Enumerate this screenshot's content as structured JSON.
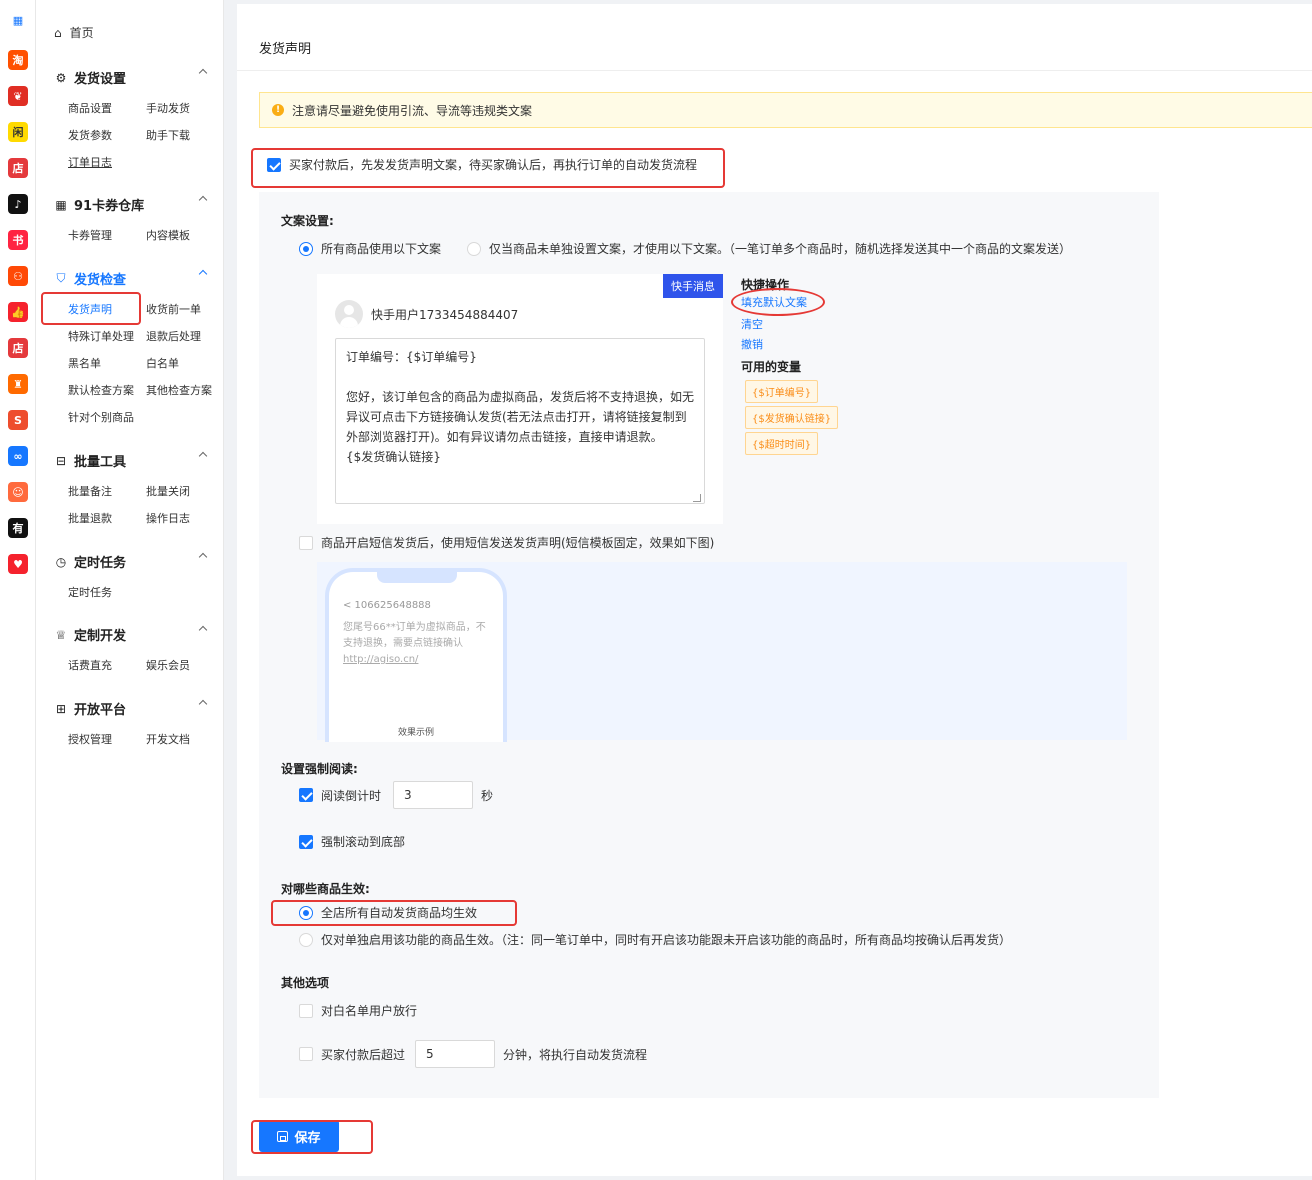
{
  "rail": {
    "items": [
      {
        "name": "qr-app-icon",
        "glyph": "▦",
        "bg": "#ffffff",
        "fg": "#1677ff"
      },
      {
        "name": "taobao-icon",
        "glyph": "淘",
        "bg": "#ff5000",
        "fg": "#ffffff"
      },
      {
        "name": "pinduoduo-icon",
        "glyph": "❦",
        "bg": "#e02e24",
        "fg": "#ffffff"
      },
      {
        "name": "xianyu-icon",
        "glyph": "闲",
        "bg": "#ffda00",
        "fg": "#333333"
      },
      {
        "name": "xiaohongshu-shop-icon",
        "glyph": "店",
        "bg": "#e4393c",
        "fg": "#ffffff"
      },
      {
        "name": "douyin-icon",
        "glyph": "♪",
        "bg": "#111111",
        "fg": "#ffffff"
      },
      {
        "name": "xiaohongshu-icon",
        "glyph": "书",
        "bg": "#ff2442",
        "fg": "#ffffff"
      },
      {
        "name": "kuaishou-icon",
        "glyph": "⚇",
        "bg": "#ff4906",
        "fg": "#ffffff"
      },
      {
        "name": "thumbs-up-icon",
        "glyph": "👍",
        "bg": "#f5222d",
        "fg": "#ffffff"
      },
      {
        "name": "store-icon",
        "glyph": "店",
        "bg": "#e4393c",
        "fg": "#ffffff"
      },
      {
        "name": "shopping-bag-icon",
        "glyph": "♜",
        "bg": "#ff6a00",
        "fg": "#ffffff"
      },
      {
        "name": "shopee-icon",
        "glyph": "S",
        "bg": "#ee4d2d",
        "fg": "#ffffff"
      },
      {
        "name": "link-icon",
        "glyph": "∞",
        "bg": "#1677ff",
        "fg": "#ffffff"
      },
      {
        "name": "smile-icon",
        "glyph": "☺",
        "bg": "#ff6a3d",
        "fg": "#ffffff"
      },
      {
        "name": "youzan-icon",
        "glyph": "有",
        "bg": "#111111",
        "fg": "#ffffff"
      },
      {
        "name": "heart-app-icon",
        "glyph": "♥",
        "bg": "#f5222d",
        "fg": "#ffffff"
      }
    ]
  },
  "sidebar": {
    "home": "首页",
    "groups": {
      "ship": {
        "title": "发货设置",
        "items": [
          "商品设置",
          "手动发货",
          "发货参数",
          "助手下载",
          "订单日志"
        ]
      },
      "card": {
        "title": "91卡券仓库",
        "items": [
          "卡券管理",
          "内容模板"
        ]
      },
      "check": {
        "title": "发货检查",
        "items": [
          "发货声明",
          "收货前一单",
          "特殊订单处理",
          "退款后处理",
          "黑名单",
          "白名单",
          "默认检查方案",
          "其他检查方案",
          "针对个别商品"
        ]
      },
      "batch": {
        "title": "批量工具",
        "items": [
          "批量备注",
          "批量关闭",
          "批量退款",
          "操作日志"
        ]
      },
      "timer": {
        "title": "定时任务",
        "items": [
          "定时任务"
        ]
      },
      "custom": {
        "title": "定制开发",
        "items": [
          "话费直充",
          "娱乐会员"
        ]
      },
      "open": {
        "title": "开放平台",
        "items": [
          "授权管理",
          "开发文档"
        ]
      }
    }
  },
  "main": {
    "title": "发货声明",
    "notice": "注意请尽量避免使用引流、导流等违规类文案",
    "enable_label": "买家付款后，先发发货声明文案，待买家确认后，再执行订单的自动发货流程",
    "copy_settings": {
      "label": "文案设置:",
      "opt_all": "所有商品使用以下文案",
      "opt_fallback": "仅当商品未单独设置文案，才使用以下文案。（一笔订单多个商品时，随机选择发送其中一个商品的文案发送）"
    },
    "message": {
      "badge": "快手消息",
      "username": "快手用户1733454884407",
      "text": "订单编号：{$订单编号}\n\n您好，该订单包含的商品为虚拟商品，发货后将不支持退换，如无异议可点击下方链接确认发货(若无法点击打开，请将链接复制到外部浏览器打开)。如有异议请勿点击链接，直接申请退款。\n{$发货确认链接}"
    },
    "quick_ops": {
      "title": "快捷操作",
      "fill": "填充默认文案",
      "clear": "清空",
      "undo": "撤销"
    },
    "variables": {
      "title": "可用的变量",
      "items": [
        "{$订单编号}",
        "{$发货确认链接}",
        "{$超时时间}"
      ]
    },
    "sms": {
      "label": "商品开启短信发货后，使用短信发送发货声明(短信模板固定，效果如下图)",
      "number": "< 106625648888",
      "text": "您尾号66**订单为虚拟商品，不支持退换，需要点链接确认",
      "link": "http://agiso.cn/",
      "caption": "效果示例"
    },
    "forced_read": {
      "label": "设置强制阅读:",
      "countdown_label": "阅读倒计时",
      "countdown_value": "3",
      "unit": "秒",
      "scroll_label": "强制滚动到底部"
    },
    "scope": {
      "label": "对哪些商品生效:",
      "opt_all": "全店所有自动发货商品均生效",
      "opt_single": "仅对单独启用该功能的商品生效。（注：同一笔订单中，同时有开启该功能跟未开启该功能的商品时，所有商品均按确认后再发货）"
    },
    "other": {
      "label": "其他选项",
      "whitelist": "对白名单用户放行",
      "timeout_prefix": "买家付款后超过",
      "timeout_value": "5",
      "timeout_suffix": "分钟，将执行自动发货流程"
    },
    "save": "保存"
  }
}
